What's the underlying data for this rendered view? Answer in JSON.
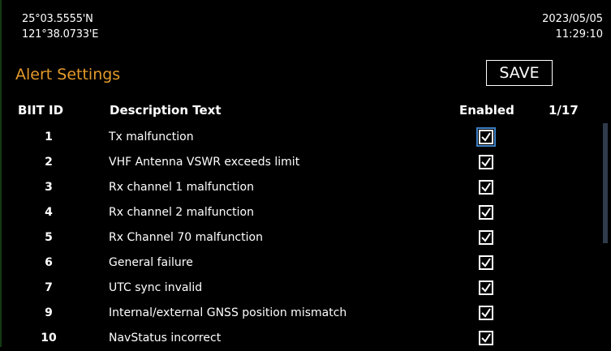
{
  "header": {
    "latitude": "25°03.5555'N",
    "longitude": "121°38.0733'E",
    "date": "2023/05/05",
    "time": "11:29:10"
  },
  "page": {
    "title": "Alert Settings",
    "save_label": "SAVE",
    "accent_color": "#e39b2a"
  },
  "table": {
    "columns": {
      "id": "BIIT ID",
      "description": "Description Text",
      "enabled": "Enabled"
    },
    "page_indicator": "1/17",
    "rows": [
      {
        "id": "1",
        "description": "Tx malfunction",
        "enabled": true
      },
      {
        "id": "2",
        "description": "VHF Antenna VSWR exceeds limit",
        "enabled": true
      },
      {
        "id": "3",
        "description": "Rx channel 1 malfunction",
        "enabled": true
      },
      {
        "id": "4",
        "description": "Rx channel 2 malfunction",
        "enabled": true
      },
      {
        "id": "5",
        "description": "Rx Channel 70 malfunction",
        "enabled": true
      },
      {
        "id": "6",
        "description": "General failure",
        "enabled": true
      },
      {
        "id": "7",
        "description": "UTC sync invalid",
        "enabled": true
      },
      {
        "id": "9",
        "description": "Internal/external GNSS position mismatch",
        "enabled": true
      },
      {
        "id": "10",
        "description": "NavStatus incorrect",
        "enabled": true
      }
    ]
  },
  "icons": {
    "checkbox_mark": "check-icon"
  }
}
